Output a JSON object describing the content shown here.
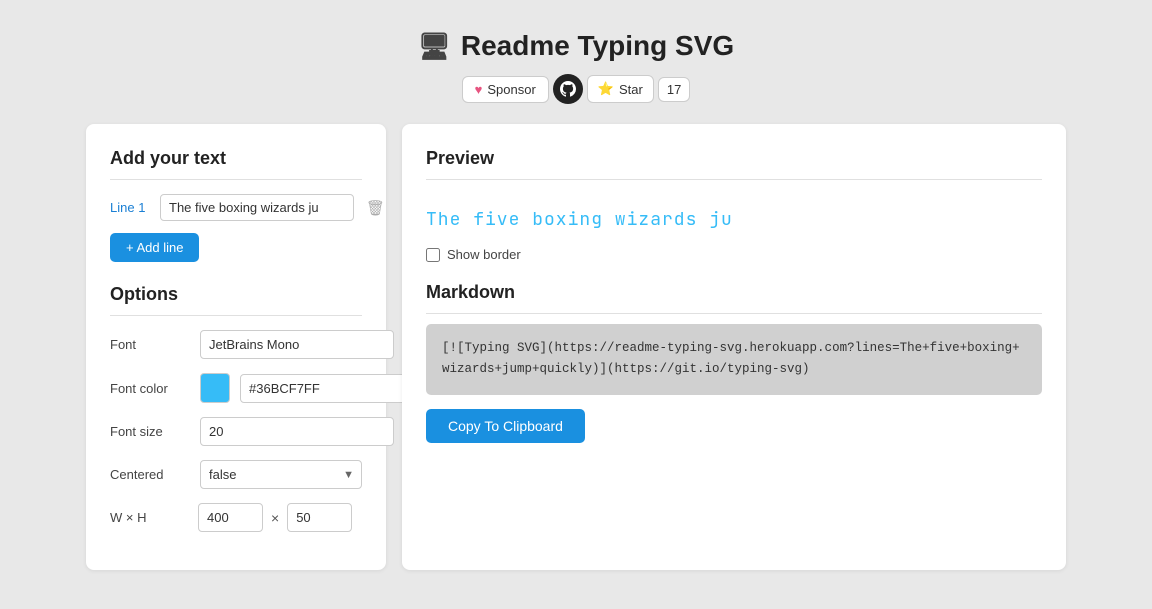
{
  "page": {
    "title": "Readme Typing SVG",
    "monitor_icon": "🖥"
  },
  "header": {
    "sponsor_label": "Sponsor",
    "star_label": "Star",
    "star_count": "17"
  },
  "left_panel": {
    "text_section_title": "Add your text",
    "line1_label": "Line 1",
    "line1_value": "The five boxing wizards ju",
    "add_line_label": "+ Add line",
    "options_title": "Options",
    "font_label": "Font",
    "font_value": "JetBrains Mono",
    "font_color_label": "Font color",
    "font_color_value": "#36BCF7FF",
    "font_color_hex": "#36BCF7",
    "font_size_label": "Font size",
    "font_size_value": "20",
    "centered_label": "Centered",
    "centered_value": "false",
    "centered_options": [
      "false",
      "true"
    ],
    "wh_label": "W × H",
    "width_value": "400",
    "height_value": "50",
    "x_sep": "×"
  },
  "right_panel": {
    "preview_title": "Preview",
    "preview_text": "The five boxing wizards ju",
    "show_border_label": "Show border",
    "markdown_title": "Markdown",
    "markdown_code": "[![Typing SVG](https://readme-typing-svg.herokuapp.com?lines=The+five+boxing+wizards+jump+quickly)](https://git.io/typing-svg)",
    "copy_btn_label": "Copy To Clipboard"
  }
}
